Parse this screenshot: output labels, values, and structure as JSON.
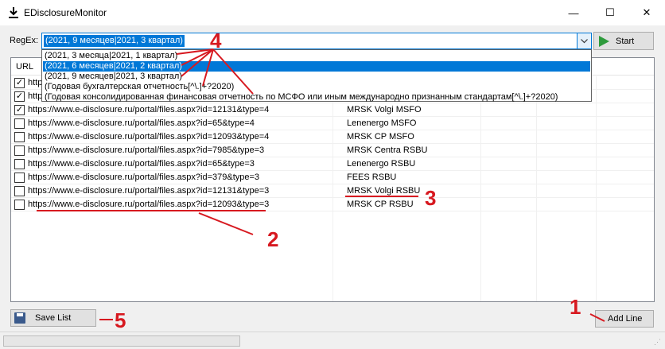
{
  "window": {
    "title": "EDisclosureMonitor",
    "minimize": "—",
    "maximize": "☐",
    "close": "✕"
  },
  "toolbar": {
    "regex_label": "RegEx:",
    "regex_value": "(2021, 9 месяцев|2021, 3 квартал)",
    "start_label": "Start"
  },
  "dropdown": {
    "options": [
      "(2021, 3 месяца|2021, 1 квартал)",
      "(2021, 6 месяцев|2021, 2 квартал)",
      "(2021, 9 месяцев|2021, 3 квартал)",
      "(Годовая бухгалтерская отчетность[^\\.]+?2020)",
      "(Годовая консолидированная финансовая отчетность по МСФО или иным международно признанным стандартам[^\\.]+?2020)"
    ],
    "selected_index": 1
  },
  "list": {
    "header_url": "URL",
    "rows": [
      {
        "checked": true,
        "url": "http",
        "name": ""
      },
      {
        "checked": true,
        "url": "http",
        "name": ""
      },
      {
        "checked": true,
        "url": "https://www.e-disclosure.ru/portal/files.aspx?id=12131&type=4",
        "name": "MRSK Volgi MSFO"
      },
      {
        "checked": false,
        "url": "https://www.e-disclosure.ru/portal/files.aspx?id=65&type=4",
        "name": "Lenenergo MSFO"
      },
      {
        "checked": false,
        "url": "https://www.e-disclosure.ru/portal/files.aspx?id=12093&type=4",
        "name": "MRSK CP MSFO"
      },
      {
        "checked": false,
        "url": "https://www.e-disclosure.ru/portal/files.aspx?id=7985&type=3",
        "name": "MRSK Centra RSBU"
      },
      {
        "checked": false,
        "url": "https://www.e-disclosure.ru/portal/files.aspx?id=65&type=3",
        "name": "Lenenergo RSBU"
      },
      {
        "checked": false,
        "url": "https://www.e-disclosure.ru/portal/files.aspx?id=379&type=3",
        "name": "FEES RSBU"
      },
      {
        "checked": false,
        "url": "https://www.e-disclosure.ru/portal/files.aspx?id=12131&type=3",
        "name": "MRSK Volgi RSBU"
      },
      {
        "checked": false,
        "url": "https://www.e-disclosure.ru/portal/files.aspx?id=12093&type=3",
        "name": "MRSK CP RSBU"
      }
    ]
  },
  "buttons": {
    "save_list": "Save List",
    "add_line": "Add Line"
  },
  "annotations": {
    "n1": "1",
    "n2": "2",
    "n3": "3",
    "n4": "4",
    "n5": "5",
    "color": "#d71920"
  }
}
